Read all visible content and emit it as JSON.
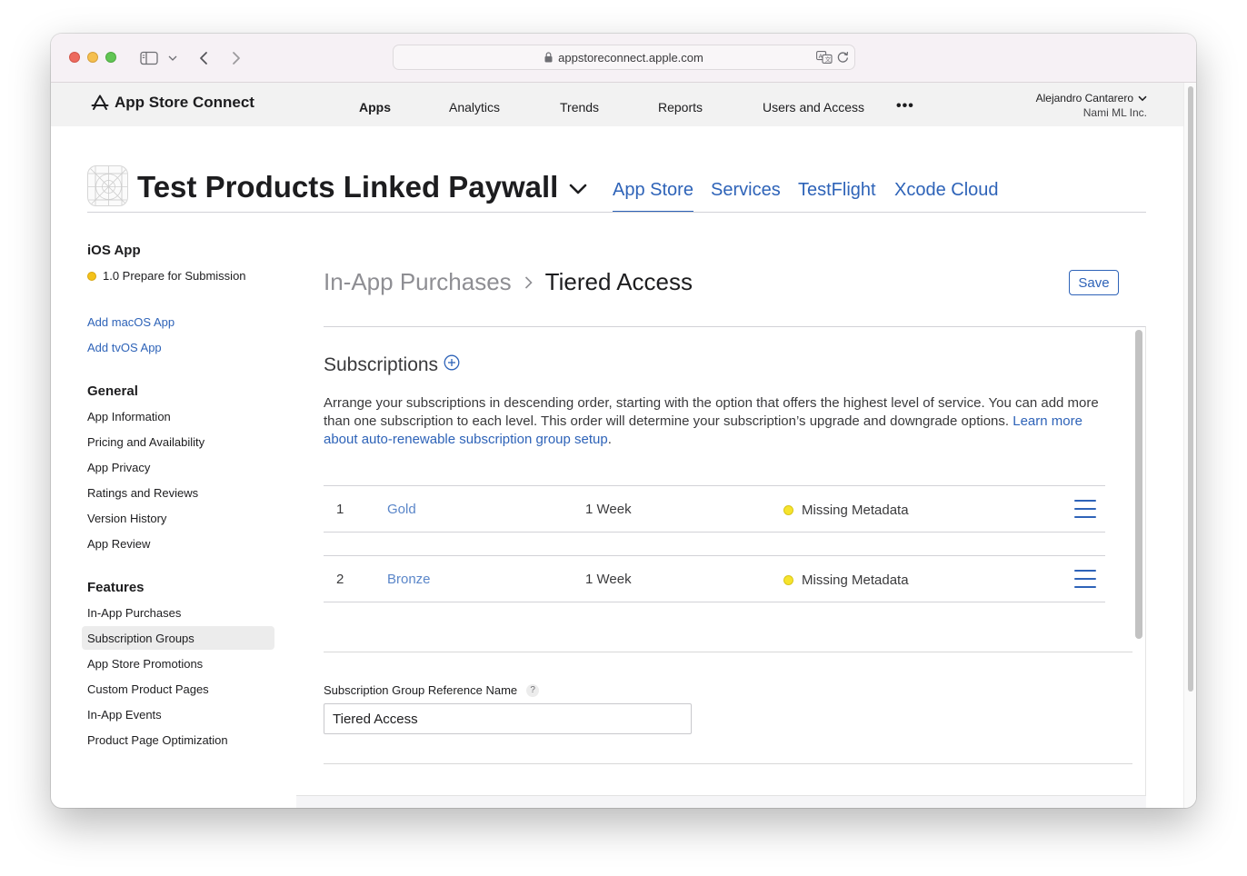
{
  "browser": {
    "url": "appstoreconnect.apple.com"
  },
  "header": {
    "logo_text": "App Store Connect",
    "nav": [
      {
        "label": "Apps",
        "active": true
      },
      {
        "label": "Analytics"
      },
      {
        "label": "Trends"
      },
      {
        "label": "Reports"
      },
      {
        "label": "Users and Access"
      }
    ],
    "more_label": "•••",
    "account_name": "Alejandro Cantarero",
    "account_org": "Nami ML Inc."
  },
  "app": {
    "title": "Test Products Linked Paywall",
    "tabs": [
      {
        "label": "App Store",
        "active": true
      },
      {
        "label": "Services"
      },
      {
        "label": "TestFlight"
      },
      {
        "label": "Xcode Cloud"
      }
    ]
  },
  "sidebar": {
    "platform_heading": "iOS App",
    "version_status": "1.0 Prepare for Submission",
    "add_links": [
      "Add macOS App",
      "Add tvOS App"
    ],
    "general_heading": "General",
    "general_items": [
      "App Information",
      "Pricing and Availability",
      "App Privacy",
      "Ratings and Reviews",
      "Version History",
      "App Review"
    ],
    "features_heading": "Features",
    "features_items": [
      "In-App Purchases",
      "Subscription Groups",
      "App Store Promotions",
      "Custom Product Pages",
      "In-App Events",
      "Product Page Optimization"
    ],
    "selected": "Subscription Groups"
  },
  "main": {
    "breadcrumb_parent": "In-App Purchases",
    "breadcrumb_current": "Tiered Access",
    "save_label": "Save",
    "subscriptions_title": "Subscriptions",
    "description": "Arrange your subscriptions in descending order, starting with the option that offers the highest level of service. You can add more than one subscription to each level. This order will determine your subscription’s upgrade and downgrade options.",
    "learn_more": "Learn more about auto-renewable subscription group setup",
    "learn_more_suffix": ".",
    "subscriptions": [
      {
        "rank": "1",
        "name": "Gold",
        "duration": "1 Week",
        "status": "Missing Metadata"
      },
      {
        "rank": "2",
        "name": "Bronze",
        "duration": "1 Week",
        "status": "Missing Metadata"
      }
    ],
    "reference_name_label": "Subscription Group Reference Name",
    "help_glyph": "?",
    "reference_name_value": "Tiered Access"
  },
  "colors": {
    "accent": "#2e63b8",
    "status_in_progress": "#f4c21a",
    "status_missing": "#f6e32c"
  }
}
